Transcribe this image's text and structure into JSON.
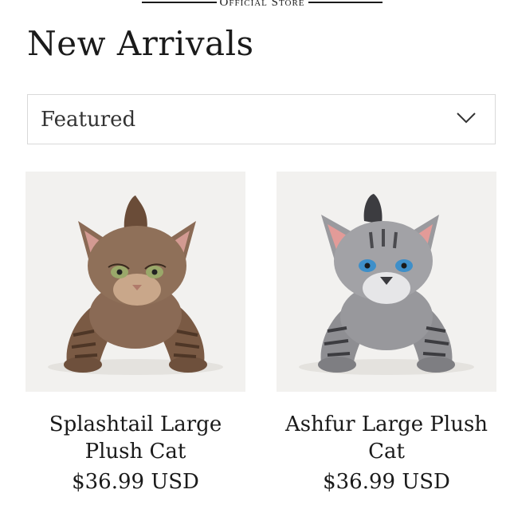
{
  "header": {
    "store_label": "Official Store"
  },
  "page": {
    "title": "New Arrivals"
  },
  "sort": {
    "selected": "Featured"
  },
  "products": [
    {
      "name": "Splashtail Large Plush Cat",
      "price": "$36.99 USD",
      "fur_color": "#8a6a55",
      "eye_color": "#9aa86a"
    },
    {
      "name": "Ashfur Large Plush Cat",
      "price": "$36.99 USD",
      "fur_color": "#8e8e92",
      "eye_color": "#3e8fc9"
    }
  ]
}
